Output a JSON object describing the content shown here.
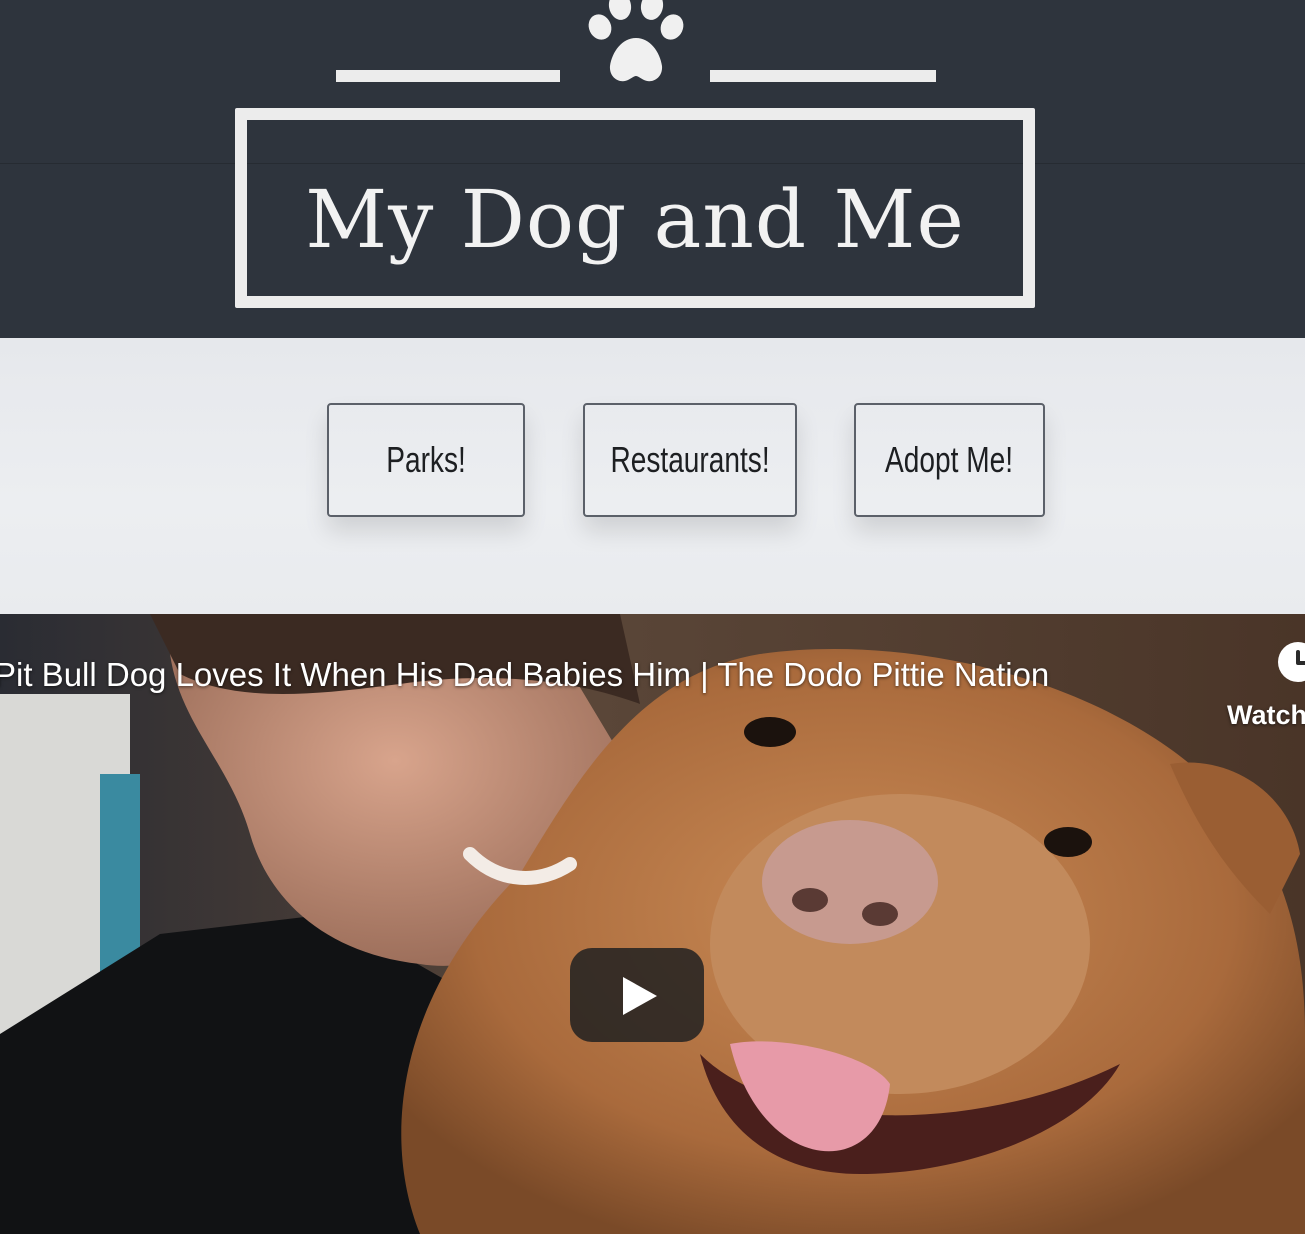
{
  "header": {
    "site_title": "My Dog and Me",
    "logo_icon": "paw-icon",
    "colors": {
      "background": "#2e343d",
      "foreground": "#ececec"
    }
  },
  "nav": {
    "items": [
      {
        "label": "Parks!"
      },
      {
        "label": "Restaurants!"
      },
      {
        "label": "Adopt Me!"
      }
    ],
    "colors": {
      "background": "#eceef1",
      "border": "#5b6069"
    }
  },
  "video": {
    "title": "Pit Bull Dog Loves It When His Dad Babies Him | The Dodo Pittie Nation",
    "watch_later_label": "Watch",
    "watch_later_icon": "clock-icon",
    "play_icon": "play-icon"
  }
}
